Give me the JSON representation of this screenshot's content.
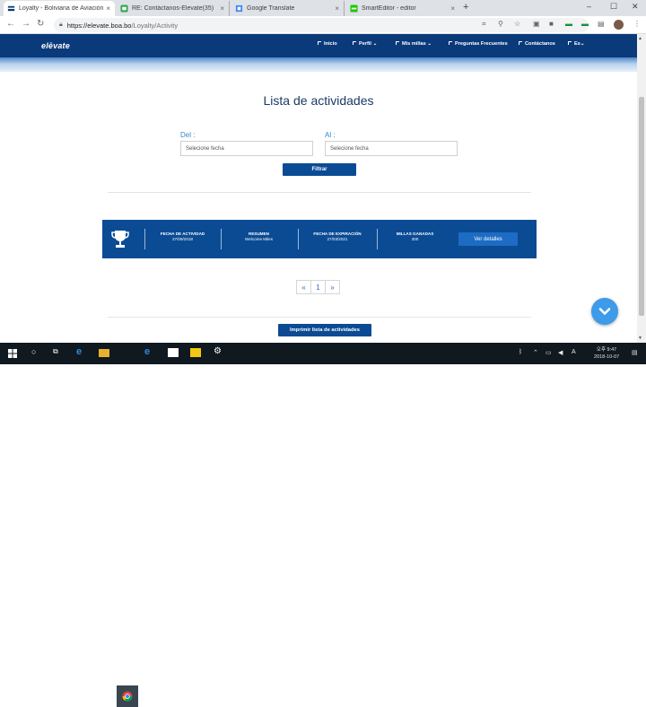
{
  "browser": {
    "tabs": [
      {
        "title": "Loyalty - Boliviana de Aviación",
        "active": true
      },
      {
        "title": "RE: Contáctanos-Elevate(35)",
        "active": false
      },
      {
        "title": "Google Translate",
        "active": false
      },
      {
        "title": "SmartEditor - editor",
        "active": false
      }
    ],
    "tab_close": "×",
    "new_tab": "+",
    "window_controls": {
      "minimize": "–",
      "maximize": "☐",
      "close": "✕"
    },
    "address": {
      "host": "https://elevate.boa.bo",
      "path": "/Loyalty/Activity"
    }
  },
  "site": {
    "logo": "elēvate",
    "nav": [
      {
        "label": "Inicio",
        "dropdown": false
      },
      {
        "label": "Perfil",
        "dropdown": true
      },
      {
        "label": "Mis millas",
        "dropdown": true
      },
      {
        "label": "Preguntas Frecuentes",
        "dropdown": false
      },
      {
        "label": "Contáctanos",
        "dropdown": false
      },
      {
        "label": "Es",
        "dropdown": true
      }
    ],
    "dropdown_caret": "⌄"
  },
  "main": {
    "title": "Lista de actividades",
    "from_label": "Del :",
    "to_label": "Al :",
    "from_placeholder": "Selecione fecha",
    "to_placeholder": "Selecione fecha",
    "filter_button": "Filtrar",
    "activity": {
      "date_header": "FECHA DE ACTIVIDAD",
      "date_value": "27/09/2018",
      "summary_header": "RESUMEN",
      "summary_value": "Welcome Miles",
      "expiry_header": "FECHA DE EXPIRACIÓN",
      "expiry_value": "27/03/2021",
      "miles_header": "MILLAS GANADAS",
      "miles_value": "300",
      "details_button": "Ver detalles"
    },
    "pagination": [
      "«",
      "1",
      "»"
    ],
    "print_button": "Imprimir lista de actividades"
  },
  "taskbar": {
    "tray_time_line1": "오후 9:47",
    "tray_time_line2": "2018-10-07"
  },
  "colors": {
    "header_bg": "#0a3a7a",
    "primary_button": "#0a4b94",
    "title_text": "#1b3a63",
    "label_blue": "#2f88c8",
    "fab": "#3d9be9"
  }
}
